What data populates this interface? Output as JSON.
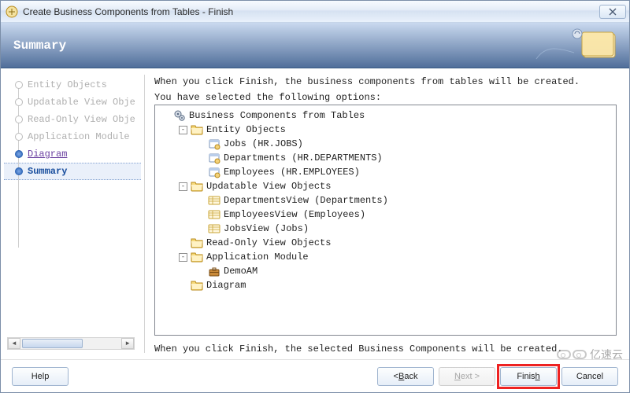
{
  "window": {
    "title": "Create Business Components from Tables - Finish"
  },
  "banner": {
    "title": "Summary"
  },
  "nav": {
    "items": [
      {
        "label": "Entity Objects",
        "state": "disabled"
      },
      {
        "label": "Updatable View Obje",
        "state": "disabled"
      },
      {
        "label": "Read-Only View Obje",
        "state": "disabled"
      },
      {
        "label": "Application Module",
        "state": "disabled"
      },
      {
        "label": "Diagram",
        "state": "link"
      },
      {
        "label": "Summary",
        "state": "current"
      }
    ]
  },
  "main": {
    "intro": "When you click Finish, the business components from tables will be created.",
    "selected_label": "You have selected the following options:",
    "footer": "When you click Finish, the selected Business Components will be created."
  },
  "tree": {
    "root": "Business Components from Tables",
    "groups": [
      {
        "label": "Entity Objects",
        "toggle": "-",
        "children": [
          {
            "label": "Jobs (HR.JOBS)",
            "icon": "entity"
          },
          {
            "label": "Departments (HR.DEPARTMENTS)",
            "icon": "entity"
          },
          {
            "label": "Employees (HR.EMPLOYEES)",
            "icon": "entity"
          }
        ]
      },
      {
        "label": "Updatable View Objects",
        "toggle": "-",
        "children": [
          {
            "label": "DepartmentsView (Departments)",
            "icon": "view"
          },
          {
            "label": "EmployeesView (Employees)",
            "icon": "view"
          },
          {
            "label": "JobsView (Jobs)",
            "icon": "view"
          }
        ]
      },
      {
        "label": "Read-Only View Objects",
        "toggle": "",
        "children": []
      },
      {
        "label": "Application Module",
        "toggle": "-",
        "children": [
          {
            "label": "DemoAM",
            "icon": "am"
          }
        ]
      },
      {
        "label": "Diagram",
        "toggle": "",
        "children": []
      }
    ]
  },
  "buttons": {
    "help": "Help",
    "back_pre": "< ",
    "back_u": "B",
    "back_post": "ack",
    "next_u": "N",
    "next_post": "ext >",
    "finish_pre": "Finis",
    "finish_u": "h",
    "cancel": "Cancel"
  },
  "watermark": "亿速云"
}
